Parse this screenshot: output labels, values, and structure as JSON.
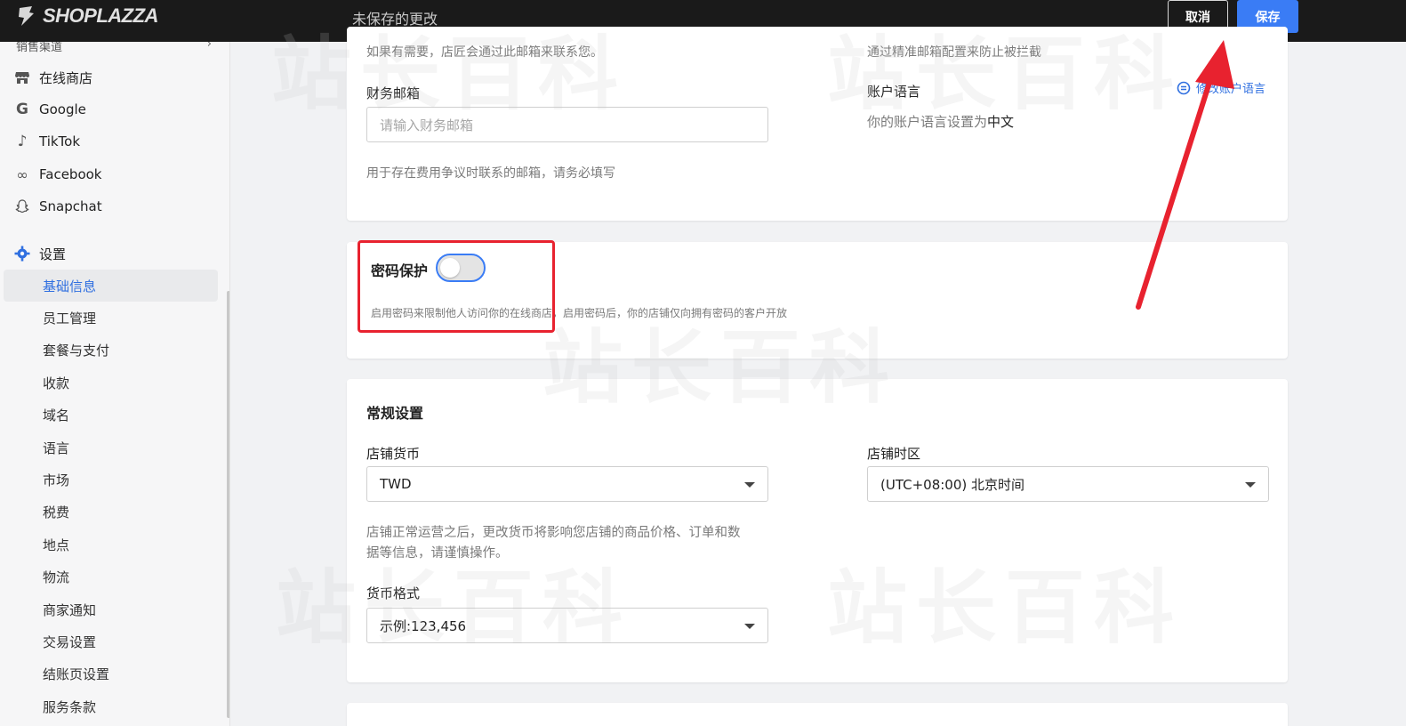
{
  "topbar": {
    "logo_text": "SHOPLAZZA",
    "unsaved_text": "未保存的更改",
    "cancel_label": "取消",
    "save_label": "保存"
  },
  "sidebar": {
    "section_label": "销售渠道",
    "channels": [
      {
        "label": "在线商店",
        "icon": "store-icon"
      },
      {
        "label": "Google",
        "icon": "google-icon"
      },
      {
        "label": "TikTok",
        "icon": "tiktok-icon"
      },
      {
        "label": "Facebook",
        "icon": "meta-icon"
      },
      {
        "label": "Snapchat",
        "icon": "snapchat-icon"
      }
    ],
    "settings_label": "设置",
    "settings_items": [
      "基础信息",
      "员工管理",
      "套餐与支付",
      "收款",
      "域名",
      "语言",
      "市场",
      "税费",
      "地点",
      "物流",
      "商家通知",
      "交易设置",
      "结账页设置",
      "服务条款"
    ],
    "active_index": 0
  },
  "contact_card": {
    "contact_hint": "如果有需要，店匠会通过此邮箱来联系您。",
    "finance_email_label": "财务邮箱",
    "finance_email_placeholder": "请输入财务邮箱",
    "finance_email_hint": "用于存在费用争议时联系的邮箱，请务必填写",
    "filter_hint": "通过精准邮箱配置来防止被拦截",
    "account_lang_label": "账户语言",
    "account_lang_link": "修改账户语言",
    "account_lang_text": "你的账户语言设置为",
    "account_lang_value": "中文"
  },
  "password_card": {
    "title": "密码保护",
    "enabled": false,
    "hint": "启用密码来限制他人访问你的在线商店，启用密码后，你的店铺仅向拥有密码的客户开放"
  },
  "general_card": {
    "title": "常规设置",
    "currency_label": "店铺货币",
    "currency_value": "TWD",
    "currency_hint_line1": "店铺正常运营之后，更改货币将影响您店铺的商品价格、订单和数",
    "currency_hint_line2": "据等信息，请谨慎操作。",
    "timezone_label": "店铺时区",
    "timezone_value": "(UTC+08:00) 北京时间",
    "format_label": "货币格式",
    "format_value": "示例:123,456"
  },
  "watermark_text": "站长百科",
  "colors": {
    "accent": "#3a7cf5",
    "annotation": "#e8222f",
    "topbar": "#1a1a1a"
  }
}
